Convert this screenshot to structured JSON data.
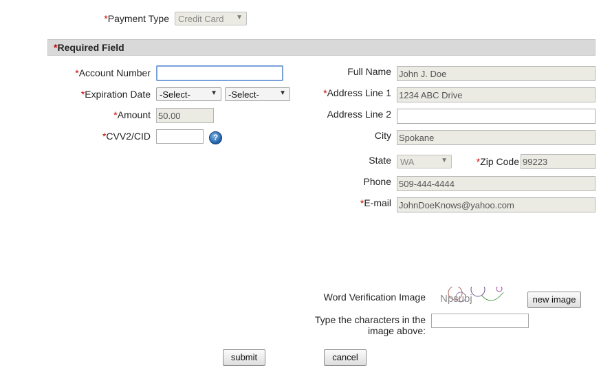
{
  "required_marker": "*",
  "payment": {
    "label": "Payment Type",
    "value": "Credit Card"
  },
  "required_field_label": "Required Field",
  "card": {
    "account_number_label": "Account Number",
    "account_number_value": "",
    "expiration_label": "Expiration Date",
    "exp_month_value": "-Select-",
    "exp_year_value": "-Select-",
    "amount_label": "Amount",
    "amount_value": "50.00",
    "cvv_label": "CVV2/CID",
    "cvv_value": ""
  },
  "billing": {
    "full_name_label": "Full Name",
    "full_name_value": "John J. Doe",
    "address1_label": "Address Line 1",
    "address1_value": "1234 ABC Drive",
    "address2_label": "Address Line 2",
    "address2_value": "",
    "city_label": "City",
    "city_value": "Spokane",
    "state_label": "State",
    "state_value": "WA",
    "zip_label": "Zip Code",
    "zip_value": "99223",
    "phone_label": "Phone",
    "phone_value": "509-444-4444",
    "email_label": "E-mail",
    "email_value": "JohnDoeKnows@yahoo.com"
  },
  "verification": {
    "image_label": "Word Verification Image",
    "captcha_text": "Npsubj",
    "new_image_label": "new image",
    "type_label_line1": "Type the characters in the",
    "type_label_line2": "image above:",
    "input_value": ""
  },
  "actions": {
    "submit_label": "submit",
    "cancel_label": "cancel"
  },
  "colors": {
    "required": "#cc0000",
    "readonly_bg": "#ebebe4",
    "header_bar": "#d9d9d9"
  }
}
